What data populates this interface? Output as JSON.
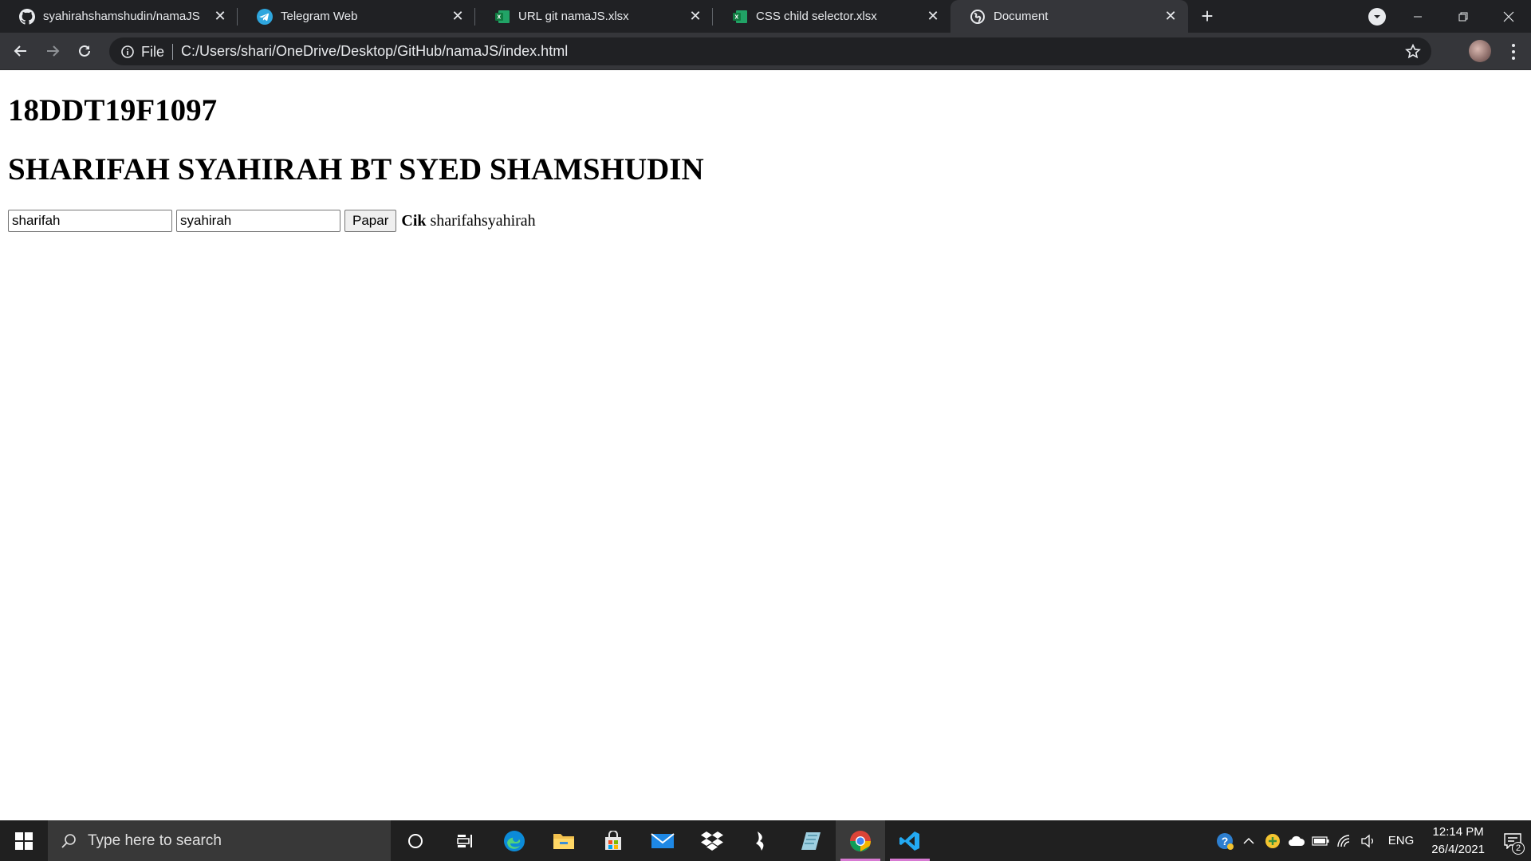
{
  "browser": {
    "tabs": [
      {
        "title": "syahirahshamshudin/namaJS",
        "icon": "github-icon",
        "active": false
      },
      {
        "title": "Telegram Web",
        "icon": "telegram-icon",
        "active": false
      },
      {
        "title": "URL git namaJS.xlsx",
        "icon": "excel-icon",
        "active": false
      },
      {
        "title": "CSS child selector.xlsx",
        "icon": "excel-icon",
        "active": false
      },
      {
        "title": "Document",
        "icon": "globe-icon",
        "active": true
      }
    ],
    "new_tab_label": "+",
    "address": {
      "scheme": "File",
      "url": "C:/Users/shari/OneDrive/Desktop/GitHub/namaJS/index.html"
    }
  },
  "page": {
    "heading_id": "18DDT19F1097",
    "heading_name": "SHARIFAH SYAHIRAH BT SYED SHAMSHUDIN",
    "form": {
      "first_input_value": "sharifah",
      "second_input_value": "syahirah",
      "button_label": "Papar",
      "output_prefix": "Cik",
      "output_text": "sharifahsyahirah"
    }
  },
  "taskbar": {
    "search_placeholder": "Type here to search",
    "language": "ENG",
    "time": "12:14 PM",
    "date": "26/4/2021",
    "notification_count": "2"
  },
  "colors": {
    "tabstrip_bg": "#202124",
    "toolbar_bg": "#35363a",
    "taskbar_bg": "#202020",
    "running_indicator": "#d77ad2"
  }
}
